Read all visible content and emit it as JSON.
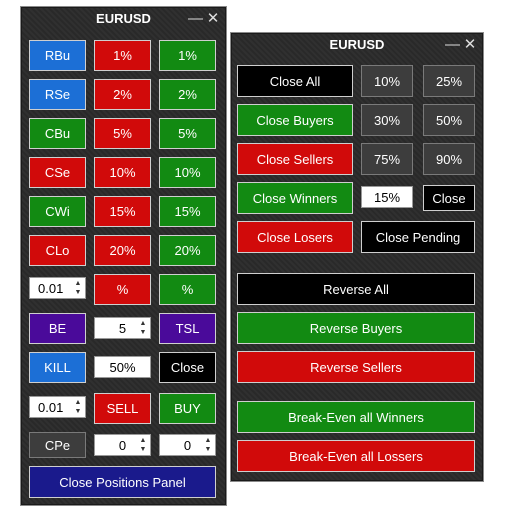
{
  "left_panel": {
    "title": "EURUSD",
    "minimize_icon": "minimize-icon",
    "close_icon": "close-icon",
    "rows": [
      {
        "a": "RBu",
        "b": "1%",
        "c": "1%"
      },
      {
        "a": "RSe",
        "b": "2%",
        "c": "2%"
      },
      {
        "a": "CBu",
        "b": "5%",
        "c": "5%"
      },
      {
        "a": "CSe",
        "b": "10%",
        "c": "10%"
      },
      {
        "a": "CWi",
        "b": "15%",
        "c": "15%"
      },
      {
        "a": "CLo",
        "b": "20%",
        "c": "20%"
      }
    ],
    "lot_value_1": "0.01",
    "pct_red": "%",
    "pct_green": "%",
    "be": "BE",
    "be_count": "5",
    "tsl": "TSL",
    "kill": "KILL",
    "kill_pct": "50%",
    "close": "Close",
    "lot_value_2": "0.01",
    "sell": "SELL",
    "buy": "BUY",
    "cpe": "CPe",
    "spin_a": "0",
    "spin_b": "0",
    "close_positions_panel": "Close Positions Panel"
  },
  "right_panel": {
    "title": "EURUSD",
    "close_all": "Close All",
    "close_buyers": "Close Buyers",
    "close_sellers": "Close Sellers",
    "close_winners": "Close Winners",
    "close_losers": "Close Losers",
    "close_pending": "Close Pending",
    "pct_10": "10%",
    "pct_25": "25%",
    "pct_30": "30%",
    "pct_50": "50%",
    "pct_75": "75%",
    "pct_90": "90%",
    "custom_pct": "15%",
    "close_small": "Close",
    "reverse_all": "Reverse All",
    "reverse_buyers": "Reverse Buyers",
    "reverse_sellers": "Reverse Sellers",
    "breakeven_winners": "Break-Even all Winners",
    "breakeven_losers": "Break-Even all Lossers"
  },
  "colors": {
    "blue": "#1c6fd6",
    "red": "#d10a0a",
    "green": "#128a12",
    "black": "#000000",
    "purple": "#4a0a9a",
    "navy": "#1a1a8c",
    "panel_bg": "#2b2b2b"
  }
}
